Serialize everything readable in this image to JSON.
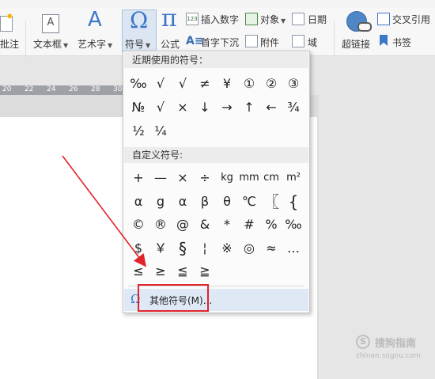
{
  "toolbar": {
    "comment_label": "批注",
    "textbox_label": "文本框",
    "art_label": "艺术字",
    "symbol_label": "符号",
    "formula_label": "公式",
    "insert_number_label": "插入数字",
    "object_label": "对象",
    "date_label": "日期",
    "drop_cap_label": "首字下沉",
    "attachment_label": "附件",
    "field_label": "域",
    "hyperlink_label": "超链接",
    "cross_ref_label": "交叉引用",
    "bookmark_label": "书签"
  },
  "ruler": {
    "ticks": [
      "20",
      "22",
      "24",
      "26",
      "28",
      "30"
    ]
  },
  "dropdown": {
    "recent_header": "近期使用的符号：",
    "recent_symbols": [
      "‰",
      "√",
      "√",
      "≠",
      "¥",
      "①",
      "②",
      "③",
      "№",
      "√",
      "×",
      "↓",
      "→",
      "↑",
      "←",
      "¾",
      "½",
      "¼"
    ],
    "custom_header": "自定义符号:",
    "custom_symbols": [
      "+",
      "—",
      "×",
      "÷",
      "kg",
      "mm",
      "cm",
      "m²",
      "α",
      "g",
      "α",
      "β",
      "θ",
      "℃",
      "〖",
      "{",
      "©",
      "®",
      "@",
      "&",
      "*",
      "#",
      "%",
      "‰",
      "$",
      "￥",
      "§",
      "¦",
      "※",
      "◎",
      "≈",
      "…",
      "≤",
      "≥",
      "≦",
      "≧"
    ],
    "more_label": "其他符号(M)..."
  },
  "watermark": {
    "brand": "搜狗指南",
    "url": "zhinan.sogou.com"
  },
  "colors": {
    "accent_blue": "#3d77c8",
    "highlight_red": "#e0232b",
    "menu_hover": "#dfe9f5"
  }
}
